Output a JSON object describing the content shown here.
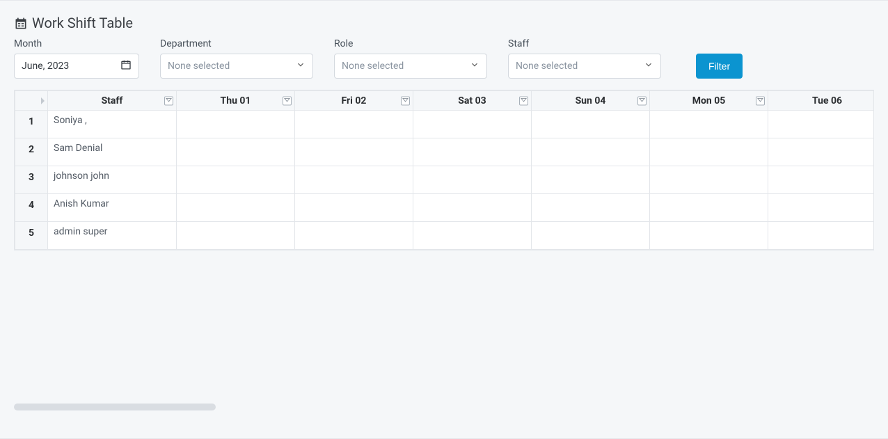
{
  "page": {
    "title": "Work Shift Table"
  },
  "filters": {
    "month": {
      "label": "Month",
      "value": "June, 2023"
    },
    "department": {
      "label": "Department",
      "selected": "None selected"
    },
    "role": {
      "label": "Role",
      "selected": "None selected"
    },
    "staff": {
      "label": "Staff",
      "selected": "None selected"
    },
    "filter_button": "Filter"
  },
  "table": {
    "headers": {
      "staff": "Staff",
      "days": [
        "Thu 01",
        "Fri 02",
        "Sat 03",
        "Sun 04",
        "Mon 05",
        "Tue 06"
      ]
    },
    "rows": [
      {
        "num": "1",
        "staff": "Soniya ,"
      },
      {
        "num": "2",
        "staff": "Sam Denial"
      },
      {
        "num": "3",
        "staff": "johnson john"
      },
      {
        "num": "4",
        "staff": "Anish Kumar"
      },
      {
        "num": "5",
        "staff": "admin super"
      }
    ]
  }
}
